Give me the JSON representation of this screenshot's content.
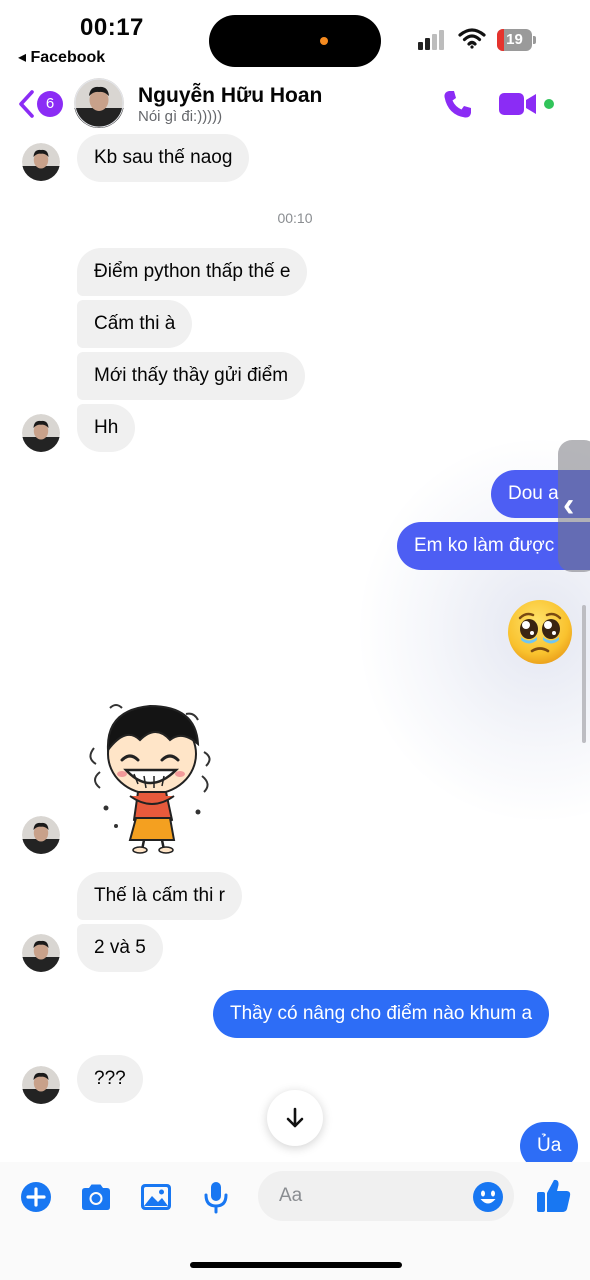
{
  "status_bar": {
    "time": "00:17",
    "back_app": "◂ Facebook",
    "battery": "19",
    "battery_level_percent": 19
  },
  "header": {
    "unread_count": "6",
    "contact_name": "Nguyễn Hữu Hoan",
    "contact_status": "Nói gì đi:)))))",
    "icons": [
      "back-chevron-icon",
      "phone-icon",
      "video-camera-icon",
      "online-status-dot"
    ]
  },
  "conversation": {
    "timestamp": "00:10",
    "messages": [
      {
        "from": "contact",
        "text": "Kb sau thế naog"
      },
      {
        "from": "contact",
        "text": "Điểm python thấp thế e"
      },
      {
        "from": "contact",
        "text": "Cấm thi à"
      },
      {
        "from": "contact",
        "text": "Mới thấy thầy gửi điểm"
      },
      {
        "from": "contact",
        "text": "Hh"
      },
      {
        "from": "me",
        "text": "Dou a"
      },
      {
        "from": "me",
        "text": "Em ko làm được"
      },
      {
        "from": "me",
        "emoji": "pleading-face"
      },
      {
        "from": "contact",
        "sticker": "crying-laughing-girl-sticker"
      },
      {
        "from": "contact",
        "text": "Thế là cấm thi r"
      },
      {
        "from": "contact",
        "text": "2 và 5"
      },
      {
        "from": "me",
        "text": "Thầy có nâng cho điểm nào khum a"
      },
      {
        "from": "contact",
        "text": "???"
      },
      {
        "from": "me",
        "text": "Ủa"
      }
    ]
  },
  "composer": {
    "placeholder": "Aa",
    "icons": [
      "plus-icon",
      "camera-icon",
      "gallery-icon",
      "microphone-icon",
      "emoji-icon",
      "thumbs-up-icon"
    ]
  },
  "colors": {
    "accent_purple": "#8b2cf5",
    "outgoing_bubble": "#4d5ef3",
    "outgoing_bubble_bottom": "#2d6df6",
    "incoming_bubble": "#f0f0f0",
    "composer_blue": "#1877f2",
    "online_green": "#31c45a"
  }
}
